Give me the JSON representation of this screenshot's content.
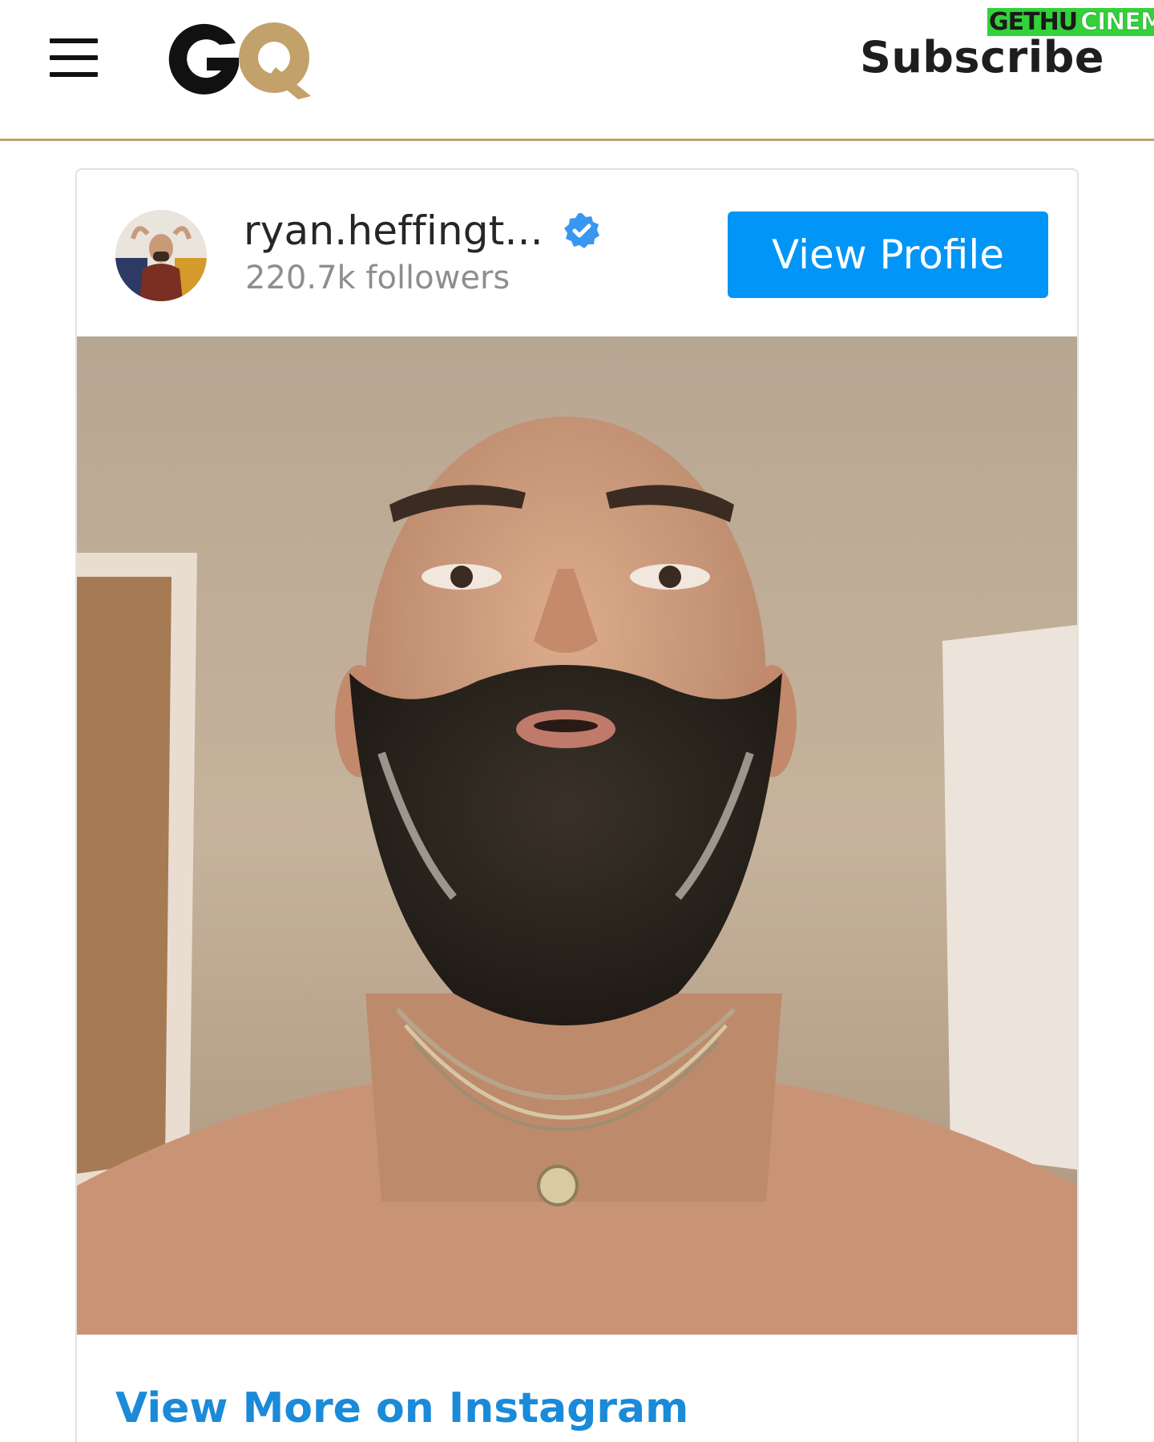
{
  "header": {
    "logo_text": "GQ",
    "subscribe_label": "Subscribe",
    "rule_color": "#c2a16b",
    "menu_icon": "hamburger-menu-icon"
  },
  "watermark": {
    "part1": "GETHU",
    "part2": "CINEMA"
  },
  "embed": {
    "username": "ryan.heffingt...",
    "verified_icon": "verified-badge-icon",
    "followers": "220.7k followers",
    "view_profile_label": "View Profile",
    "view_more_label": "View More on Instagram",
    "accent_color": "#0095f6"
  }
}
